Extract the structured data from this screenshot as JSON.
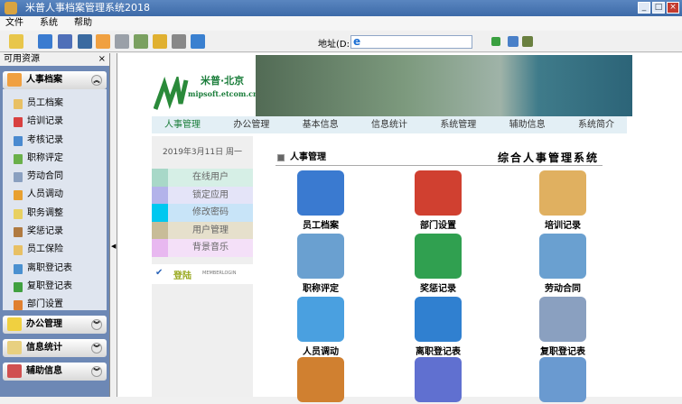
{
  "window": {
    "title": "米普人事档案管理系统2018"
  },
  "menu": [
    "文件",
    "系统",
    "帮助"
  ],
  "address": {
    "label": "地址(D:)",
    "value": ""
  },
  "sidebar": {
    "title": "可用资源",
    "close": "×",
    "groups": [
      {
        "label": "人事档案",
        "expanded": true,
        "items": [
          "员工档案",
          "培训记录",
          "考核记录",
          "职称评定",
          "劳动合同",
          "人员调动",
          "职务调整",
          "奖惩记录",
          "员工保险",
          "离职登记表",
          "复职登记表",
          "部门设置"
        ]
      },
      {
        "label": "办公管理"
      },
      {
        "label": "信息统计"
      },
      {
        "label": "辅助信息"
      }
    ]
  },
  "brand": {
    "name": "米普·北京",
    "url": "mipsoft.etcom.cn"
  },
  "nav": [
    "人事管理",
    "办公管理",
    "基本信息",
    "信息统计",
    "系统管理",
    "辅助信息",
    "系统简介"
  ],
  "leftpanel": {
    "date": "2019年3月11日 周一",
    "items": [
      {
        "label": "在线用户",
        "color": "#a8d8c8",
        "bg": "#d6efe6"
      },
      {
        "label": "锁定应用",
        "color": "#b3b3ea",
        "bg": "#e4e4f8"
      },
      {
        "label": "修改密码",
        "color": "#00c8f0",
        "bg": "#c8e4f8"
      },
      {
        "label": "用户管理",
        "color": "#c8bc98",
        "bg": "#e6e0cc"
      },
      {
        "label": "背景音乐",
        "color": "#e8b8f0",
        "bg": "#f4e0f8"
      }
    ],
    "login": {
      "label": "登陆",
      "sub": "MEMBERLOGIN"
    }
  },
  "section": {
    "title": "人事管理",
    "system": "综合人事管理系统"
  },
  "modules": [
    [
      "员工档案",
      "部门设置",
      "培训记录"
    ],
    [
      "职称评定",
      "奖惩记录",
      "劳动合同"
    ],
    [
      "人员调动",
      "离职登记表",
      "复职登记表"
    ],
    [
      "",
      "",
      ""
    ]
  ]
}
